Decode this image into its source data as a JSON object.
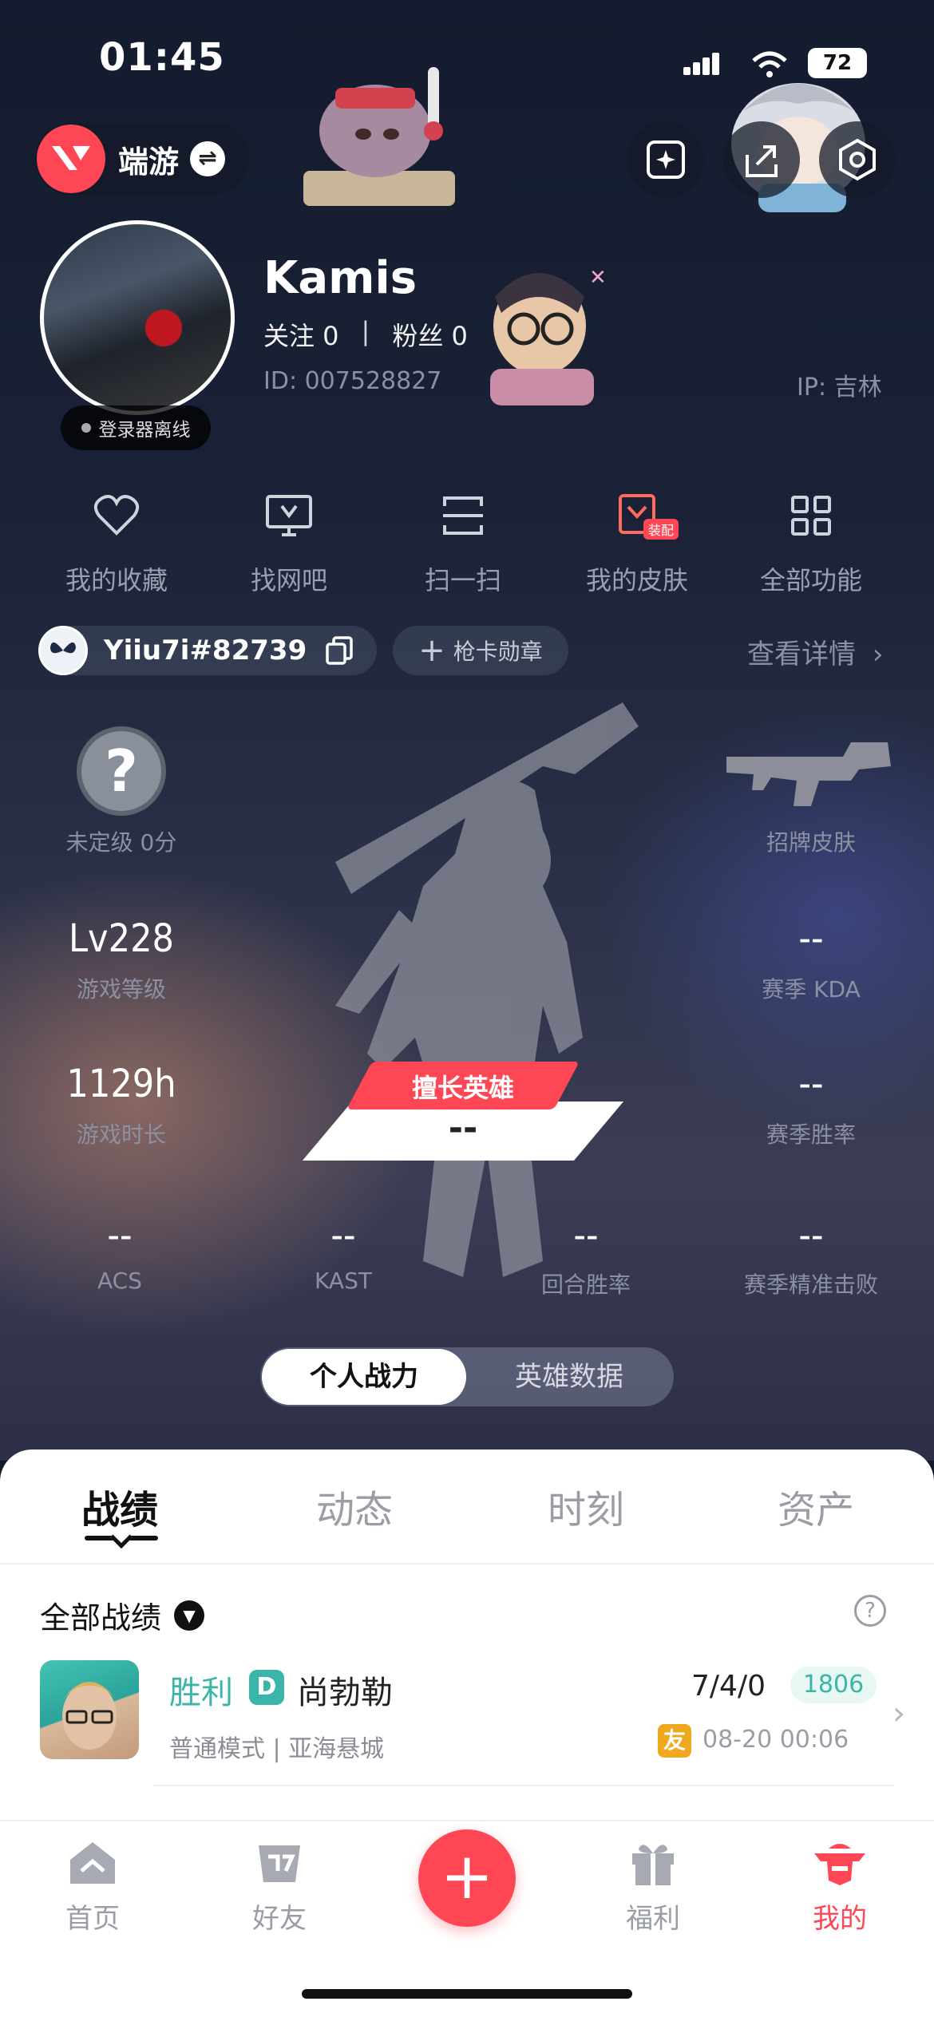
{
  "status_bar": {
    "time": "01:45",
    "battery": "72"
  },
  "header": {
    "app_name": "端游"
  },
  "profile": {
    "username": "Kamis",
    "following_label": "关注 0",
    "divider": "|",
    "followers_label": "粉丝 0",
    "uid": "ID: 007528827",
    "ip": "IP: 吉林",
    "status": "登录器离线"
  },
  "quick_actions": [
    {
      "label": "我的收藏",
      "icon": "heart-icon"
    },
    {
      "label": "找网吧",
      "icon": "monitor-icon"
    },
    {
      "label": "扫一扫",
      "icon": "scan-icon"
    },
    {
      "label": "我的皮肤",
      "icon": "skin-icon",
      "badge": "装配"
    },
    {
      "label": "全部功能",
      "icon": "grid-icon"
    }
  ],
  "riot": {
    "id": "Yiiu7i#82739",
    "card_button": "枪卡勋章",
    "detail_link": "查看详情"
  },
  "stats": {
    "rank_label": "未定级 0分",
    "rank_symbol": "?",
    "skin_label": "招牌皮肤",
    "level_value": "Lv228",
    "level_label": "游戏等级",
    "kda_value": "--",
    "kda_label": "赛季 KDA",
    "hours_value": "1129h",
    "hours_label": "游戏时长",
    "winrate_value": "--",
    "winrate_label": "赛季胜率",
    "best_hero_tag": "擅长英雄",
    "best_hero_value": "--",
    "acs_value": "--",
    "acs_label": "ACS",
    "kast_value": "--",
    "kast_label": "KAST",
    "round_value": "--",
    "round_label": "回合胜率",
    "hs_value": "--",
    "hs_label": "赛季精准击败"
  },
  "segment": {
    "active": "个人战力",
    "inactive": "英雄数据"
  },
  "tabs": [
    {
      "label": "战绩",
      "active": true
    },
    {
      "label": "动态",
      "active": false
    },
    {
      "label": "时刻",
      "active": false
    },
    {
      "label": "资产",
      "active": false
    }
  ],
  "records": {
    "filter": "全部战绩",
    "help": "?",
    "match": {
      "result": "胜利",
      "rank_letter": "D",
      "agent": "尚勃勒",
      "mode": "普通模式 | 亚海悬城",
      "kda": "7/4/0",
      "score": "1806",
      "friend_tag": "友",
      "time": "08-20 00:06"
    }
  },
  "bottom_nav": [
    {
      "label": "首页",
      "icon": "home-icon",
      "active": false
    },
    {
      "label": "好友",
      "icon": "friends-icon",
      "active": false
    },
    {
      "label": "福利",
      "icon": "gift-icon",
      "active": false
    },
    {
      "label": "我的",
      "icon": "profile-agent-icon",
      "active": true
    }
  ],
  "fab": "+",
  "colors": {
    "accent": "#ff4655",
    "win": "#3bb5a8",
    "friend": "#f0a81e"
  }
}
